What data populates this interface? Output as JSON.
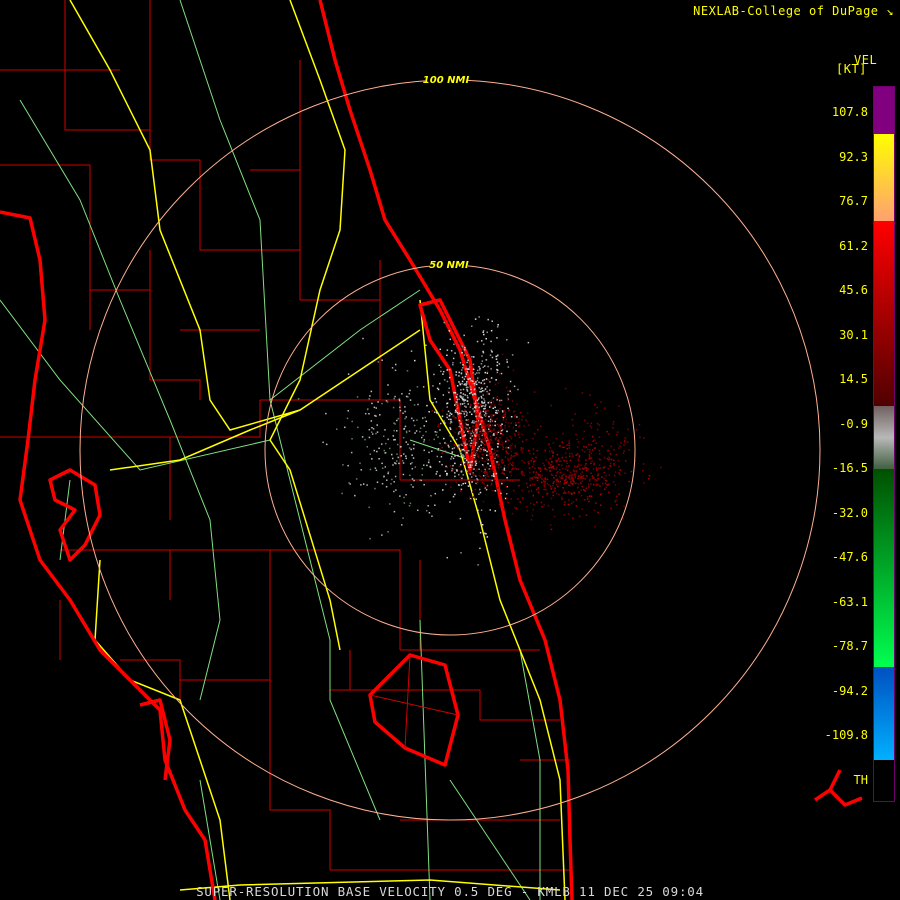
{
  "header": {
    "credit": "NEXLAB-College of DuPage",
    "credit_icon": "nexlab-logo-icon"
  },
  "legend": {
    "product": "VEL",
    "units": "[KT]",
    "ticks": [
      "107.8",
      "92.3",
      "76.7",
      "61.2",
      "45.6",
      "30.1",
      "14.5",
      "-0.9",
      "-16.5",
      "-32.0",
      "-47.6",
      "-63.1",
      "-78.7",
      "-94.2",
      "-109.8",
      "TH"
    ],
    "segments": [
      {
        "color": "#800080"
      },
      {
        "color": "#ffff00",
        "to": "#ffa070"
      },
      {
        "color": "#ff0000",
        "to": "#500000"
      },
      {
        "color": "#706060",
        "to": "#b8b8b8",
        "end": "#406040"
      },
      {
        "color": "#005000",
        "to": "#00ff50"
      },
      {
        "color": "#0050c0",
        "to": "#00b0ff"
      }
    ]
  },
  "map": {
    "range_rings": [
      {
        "label": "50 NMI",
        "nmi": 50
      },
      {
        "label": "100 NMI",
        "nmi": 100
      }
    ],
    "colors": {
      "coast": "#ff0000",
      "county": "#e00000",
      "highway": "#ffff00",
      "road": "#80e080",
      "ring": "#ffb090"
    }
  },
  "footer": {
    "title": "SUPER-RESOLUTION BASE VELOCITY 0.5 DEG - KMLB 11 DEC 25 09:04"
  }
}
